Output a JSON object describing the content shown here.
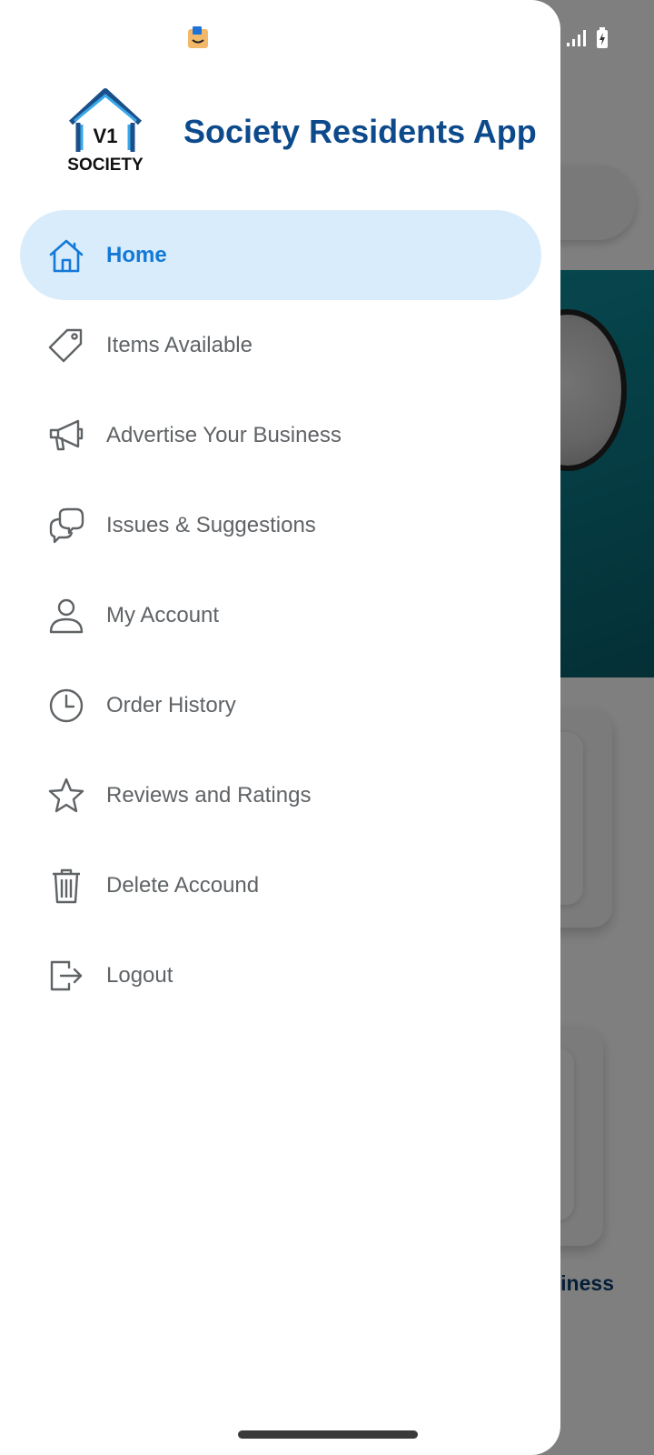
{
  "app": {
    "title": "Society Residents App",
    "logo_top_text": "V1",
    "logo_bottom_text": "SOCIETY"
  },
  "menu": {
    "items": [
      {
        "label": "Home",
        "icon": "home-icon",
        "active": true
      },
      {
        "label": "Items Available",
        "icon": "tag-icon",
        "active": false
      },
      {
        "label": "Advertise Your Business",
        "icon": "megaphone-icon",
        "active": false
      },
      {
        "label": "Issues & Suggestions",
        "icon": "chat-bubbles-icon",
        "active": false
      },
      {
        "label": "My Account",
        "icon": "user-icon",
        "active": false
      },
      {
        "label": "Order History",
        "icon": "clock-icon",
        "active": false
      },
      {
        "label": "Reviews and Ratings",
        "icon": "star-icon",
        "active": false
      },
      {
        "label": "Delete Accound",
        "icon": "trash-icon",
        "active": false
      },
      {
        "label": "Logout",
        "icon": "logout-icon",
        "active": false
      }
    ]
  },
  "background": {
    "partial_label": "iness"
  },
  "colors": {
    "accent": "#1479d6",
    "active_bg": "#d9ecfb",
    "title": "#0d4a8c",
    "menu_text": "#5f6366"
  }
}
